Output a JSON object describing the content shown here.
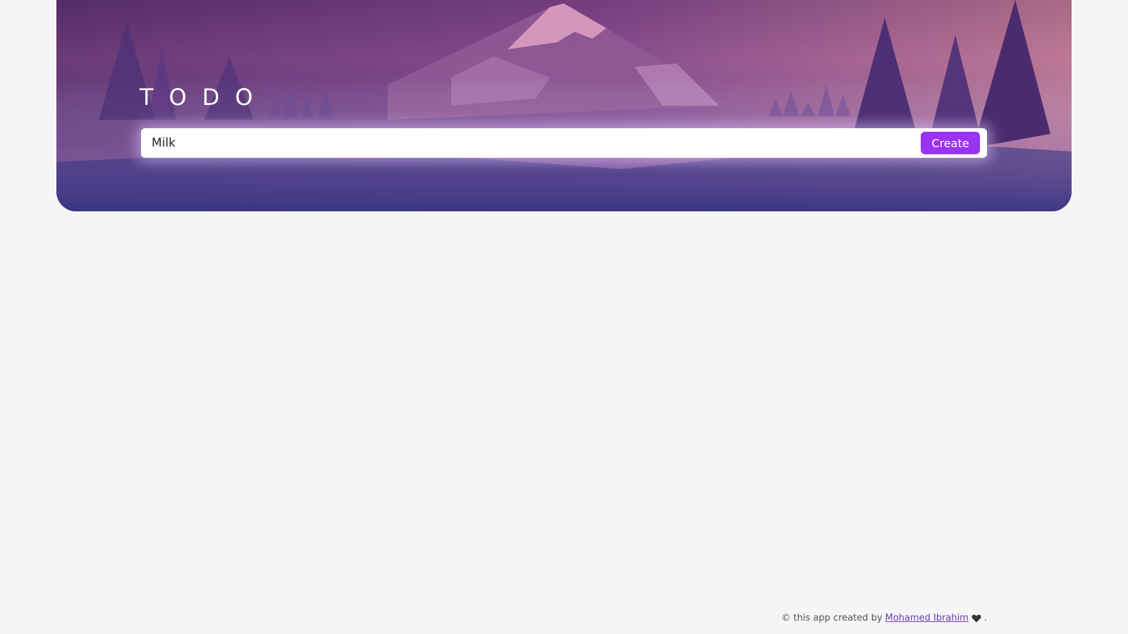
{
  "header": {
    "title": "TODO"
  },
  "todo_form": {
    "input_value": "Milk",
    "create_label": "Create"
  },
  "footer": {
    "prefix": "© this app created by",
    "author_link": "Mohamed Ibrahim",
    "heart_icon": "heart-icon",
    "suffix": "."
  },
  "colors": {
    "accent": "#9b33f2",
    "page_bg": "#f5f5f5",
    "hero_top": "#5a2f6c",
    "hero_bottom": "#3c3583"
  }
}
